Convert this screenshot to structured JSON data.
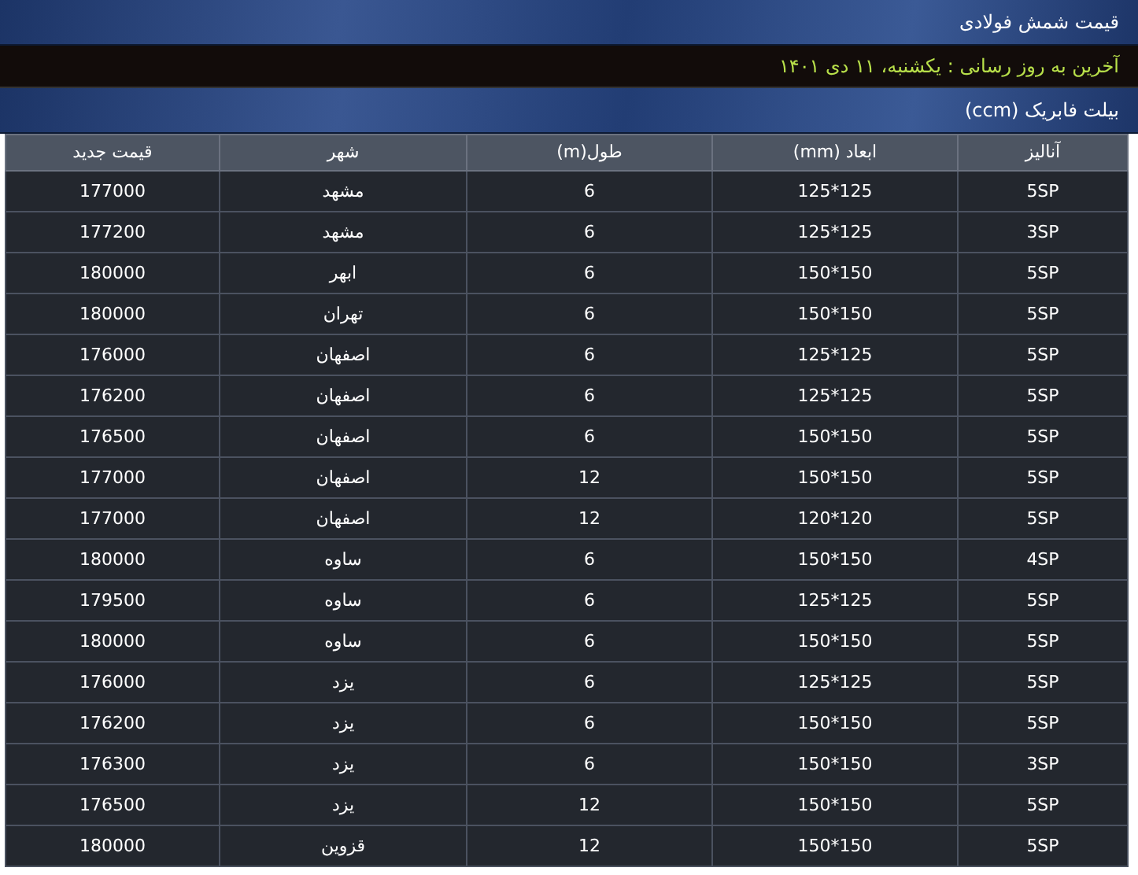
{
  "header": {
    "title": "قیمت شمش فولادی"
  },
  "update_bar": {
    "text": "آخرین به روز رسانی : یکشنبه، ۱۱ دی ۱۴۰۱"
  },
  "section": {
    "title": "بیلت فابریک (ccm)"
  },
  "table": {
    "columns": [
      "آنالیز",
      "ابعاد (mm)",
      "طول(m)",
      "شهر",
      "قیمت جدید"
    ],
    "rows": [
      [
        "5SP",
        "125*125",
        "6",
        "مشهد",
        "177000"
      ],
      [
        "3SP",
        "125*125",
        "6",
        "مشهد",
        "177200"
      ],
      [
        "5SP",
        "150*150",
        "6",
        "ابهر",
        "180000"
      ],
      [
        "5SP",
        "150*150",
        "6",
        "تهران",
        "180000"
      ],
      [
        "5SP",
        "125*125",
        "6",
        "اصفهان",
        "176000"
      ],
      [
        "5SP",
        "125*125",
        "6",
        "اصفهان",
        "176200"
      ],
      [
        "5SP",
        "150*150",
        "6",
        "اصفهان",
        "176500"
      ],
      [
        "5SP",
        "150*150",
        "12",
        "اصفهان",
        "177000"
      ],
      [
        "5SP",
        "120*120",
        "12",
        "اصفهان",
        "177000"
      ],
      [
        "4SP",
        "150*150",
        "6",
        "ساوه",
        "180000"
      ],
      [
        "5SP",
        "125*125",
        "6",
        "ساوه",
        "179500"
      ],
      [
        "5SP",
        "150*150",
        "6",
        "ساوه",
        "180000"
      ],
      [
        "5SP",
        "125*125",
        "6",
        "یزد",
        "176000"
      ],
      [
        "5SP",
        "150*150",
        "6",
        "یزد",
        "176200"
      ],
      [
        "3SP",
        "150*150",
        "6",
        "یزد",
        "176300"
      ],
      [
        "5SP",
        "150*150",
        "12",
        "یزد",
        "176500"
      ],
      [
        "5SP",
        "150*150",
        "12",
        "قزوین",
        "180000"
      ]
    ]
  }
}
